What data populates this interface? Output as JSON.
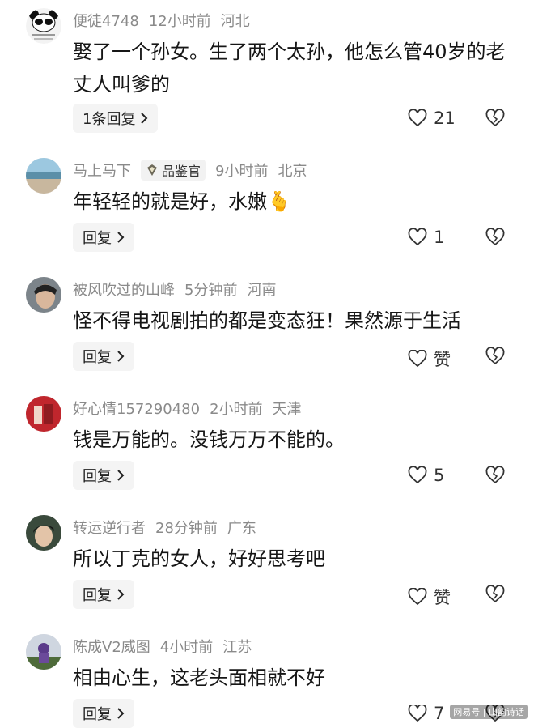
{
  "comments": [
    {
      "user": "便徒4748",
      "time": "12小时前",
      "location": "河北",
      "text": "娶了一个孙女。生了两个太孙，他怎么管40岁的老丈人叫爹的",
      "reply_label": "1条回复",
      "likes": "21"
    },
    {
      "user": "马上马下",
      "badge": "品鉴官",
      "time": "9小时前",
      "location": "北京",
      "text": "年轻轻的就是好，水嫩🫰",
      "reply_label": "回复",
      "likes": "1"
    },
    {
      "user": "被风吹过的山峰",
      "time": "5分钟前",
      "location": "河南",
      "text": "怪不得电视剧拍的都是变态狂！果然源于生活",
      "reply_label": "回复",
      "likes": "赞"
    },
    {
      "user": "好心情157290480",
      "time": "2小时前",
      "location": "天津",
      "text": "钱是万能的。没钱万万不能的。",
      "reply_label": "回复",
      "likes": "5"
    },
    {
      "user": "转运逆行者",
      "time": "28分钟前",
      "location": "广东",
      "text": "所以丁克的女人，好好思考吧",
      "reply_label": "回复",
      "likes": "赞"
    },
    {
      "user": "陈成V2威图",
      "time": "4小时前",
      "location": "江苏",
      "text": "相由心生，这老头面相就不好",
      "reply_label": "回复",
      "likes": "7"
    }
  ],
  "watermark": "网易号 | 山韵诗话",
  "colors": {
    "meta": "#8a8a8a",
    "text": "#161616",
    "reply_bg": "#f4f4f4"
  },
  "icons": {
    "like": "heart-outline-icon",
    "dislike": "broken-heart-icon",
    "reply_chevron": "chevron-right-icon"
  }
}
